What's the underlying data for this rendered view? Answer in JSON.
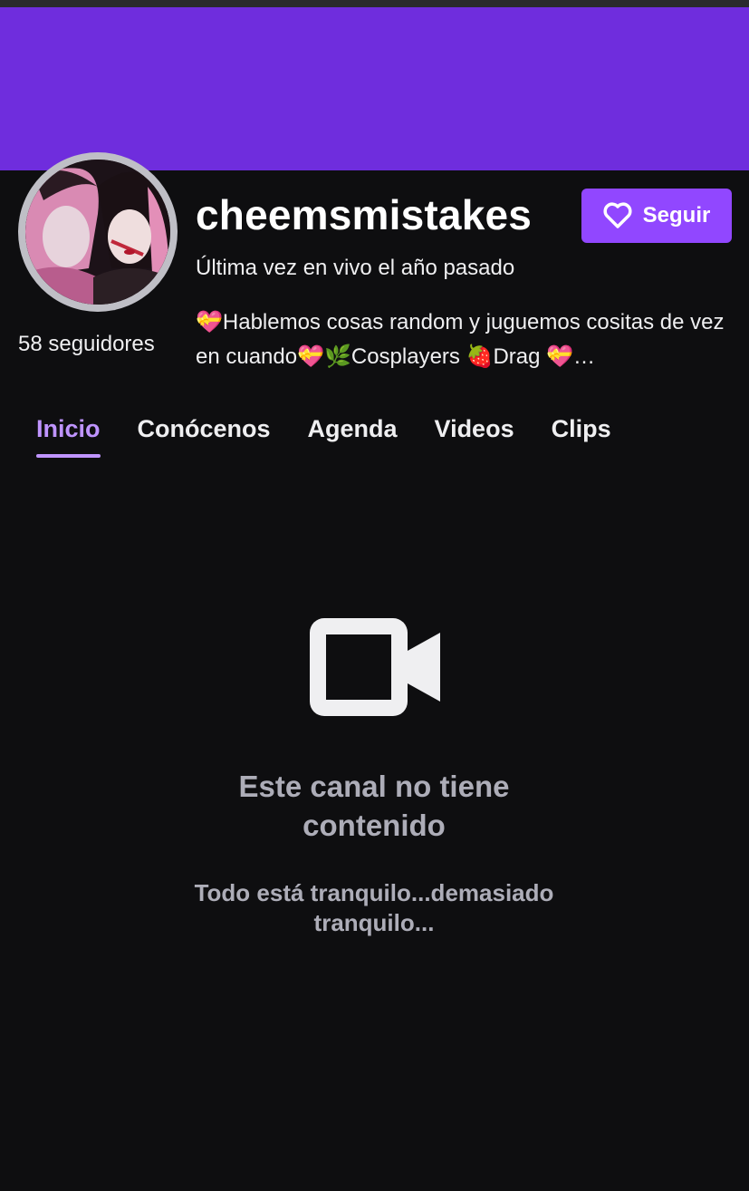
{
  "channel": {
    "name": "cheemsmistakes",
    "last_live": "Última vez en vivo el año pasado",
    "followers": "58 seguidores",
    "description": "💝Hablemos cosas random y juguemos cositas de vez en cuando💝🌿Cosplayers 🍓Drag 💝…",
    "banner_color": "#6f2ddd"
  },
  "follow_button": {
    "label": "Seguir",
    "icon": "heart-outline-icon",
    "color": "#9147ff"
  },
  "tabs": [
    {
      "label": "Inicio",
      "active": true
    },
    {
      "label": "Conócenos",
      "active": false
    },
    {
      "label": "Agenda",
      "active": false
    },
    {
      "label": "Videos",
      "active": false
    },
    {
      "label": "Clips",
      "active": false
    }
  ],
  "empty_state": {
    "icon": "video-camera-icon",
    "title": "Este canal no tiene contenido",
    "subtitle": "Todo está tranquilo...demasiado tranquilo..."
  },
  "colors": {
    "accent": "#bf94ff",
    "background": "#0e0e10",
    "muted_text": "#adadb8"
  }
}
